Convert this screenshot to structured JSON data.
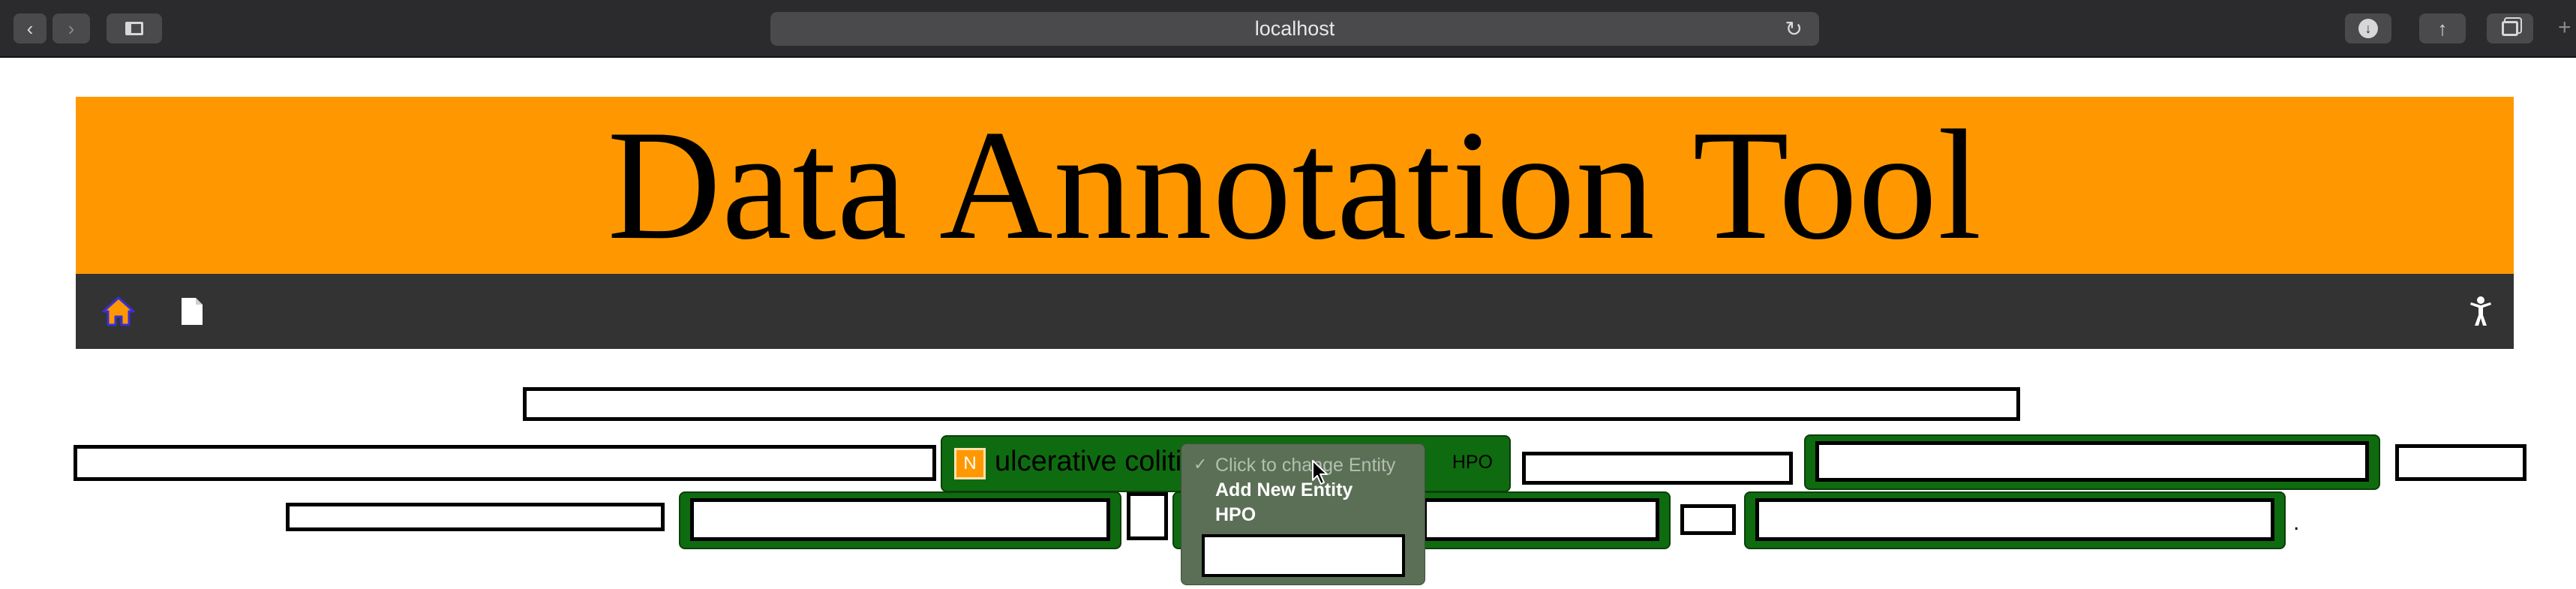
{
  "browser": {
    "url": "localhost",
    "icons": {
      "back": "chevron-left-icon",
      "forward": "chevron-right-icon",
      "sidebar": "sidebar-icon",
      "reload": "reload-icon",
      "downloads": "download-icon",
      "share": "share-icon",
      "tabs": "tabs-icon"
    }
  },
  "header": {
    "title": "Data Annotation Tool",
    "banner_color": "#ff9800"
  },
  "navbar": {
    "background": "#333333",
    "items": [
      {
        "icon": "home-icon",
        "color": "#ff9800"
      },
      {
        "icon": "document-icon",
        "color": "#ffffff"
      },
      {
        "icon": "accessibility-icon",
        "color": "#ffffff"
      }
    ]
  },
  "annotations": {
    "selected_entity": {
      "badge": "N",
      "text": "ulcerative colitis",
      "tag": "HPO",
      "color": "#0f6b0f"
    }
  },
  "dropdown": {
    "title": "Click to change Entity",
    "options": [
      "Add New Entity",
      "HPO"
    ],
    "input_value": ""
  },
  "text_fragments": {
    "period": "."
  }
}
